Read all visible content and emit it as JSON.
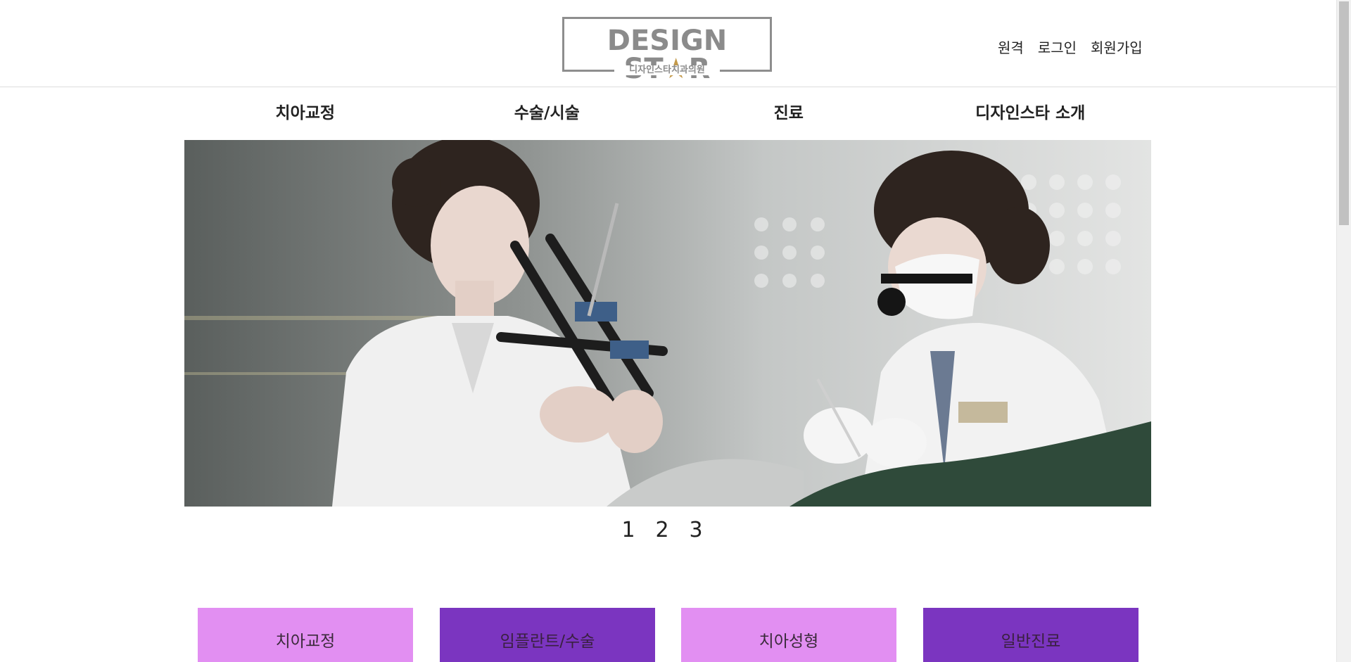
{
  "header": {
    "logo": {
      "main_before": "DESIGN ST",
      "star": "★",
      "main_after": "R",
      "sub": "디자인스타치과의원"
    },
    "util_links": [
      "원격",
      "로그인",
      "회원가입"
    ]
  },
  "gnb": {
    "items": [
      "치아교정",
      "수술/시술",
      "진료",
      "디자인스타 소개"
    ]
  },
  "hero": {
    "pager": [
      "1",
      "2",
      "3"
    ],
    "active_page": 1
  },
  "tiles": [
    {
      "label": "치아교정",
      "color": "#e28ff2"
    },
    {
      "label": "임플란트/수술",
      "color": "#7b35c0"
    },
    {
      "label": "치아성형",
      "color": "#e28ff2"
    },
    {
      "label": "일반진료",
      "color": "#7b35c0"
    }
  ],
  "colors": {
    "accent_pink": "#e28ff2",
    "accent_purple": "#7b35c0",
    "logo_gray": "#8b8b8b",
    "logo_star": "#c49a4a"
  }
}
